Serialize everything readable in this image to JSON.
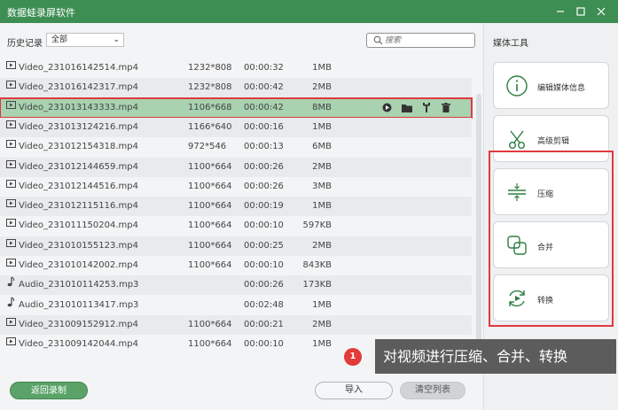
{
  "app": {
    "title": "数据蛙录屏软件"
  },
  "toolbar": {
    "history_label": "历史记录",
    "filter_value": "全部",
    "search_placeholder": "搜索"
  },
  "files": [
    {
      "type": "video",
      "name": "Video_231016142514.mp4",
      "resolution": "1232*808",
      "duration": "00:00:32",
      "size": "1MB"
    },
    {
      "type": "video",
      "name": "Video_231016142317.mp4",
      "resolution": "1232*808",
      "duration": "00:00:42",
      "size": "2MB"
    },
    {
      "type": "video",
      "name": "Video_231013143333.mp4",
      "resolution": "1106*668",
      "duration": "00:00:42",
      "size": "8MB",
      "selected": true
    },
    {
      "type": "video",
      "name": "Video_231013124216.mp4",
      "resolution": "1166*640",
      "duration": "00:00:16",
      "size": "1MB"
    },
    {
      "type": "video",
      "name": "Video_231012154318.mp4",
      "resolution": "972*546",
      "duration": "00:00:13",
      "size": "6MB"
    },
    {
      "type": "video",
      "name": "Video_231012144659.mp4",
      "resolution": "1100*664",
      "duration": "00:00:26",
      "size": "2MB"
    },
    {
      "type": "video",
      "name": "Video_231012144516.mp4",
      "resolution": "1100*664",
      "duration": "00:00:26",
      "size": "3MB"
    },
    {
      "type": "video",
      "name": "Video_231012115116.mp4",
      "resolution": "1100*664",
      "duration": "00:00:19",
      "size": "1MB"
    },
    {
      "type": "video",
      "name": "Video_231011150204.mp4",
      "resolution": "1100*664",
      "duration": "00:00:10",
      "size": "597KB"
    },
    {
      "type": "video",
      "name": "Video_231010155123.mp4",
      "resolution": "1100*664",
      "duration": "00:00:25",
      "size": "2MB"
    },
    {
      "type": "video",
      "name": "Video_231010142002.mp4",
      "resolution": "1100*664",
      "duration": "00:00:10",
      "size": "843KB"
    },
    {
      "type": "audio",
      "name": "Audio_231010114253.mp3",
      "resolution": "",
      "duration": "00:00:26",
      "size": "173KB"
    },
    {
      "type": "audio",
      "name": "Audio_231010113417.mp3",
      "resolution": "",
      "duration": "00:02:48",
      "size": "1MB"
    },
    {
      "type": "video",
      "name": "Video_231009152912.mp4",
      "resolution": "1100*664",
      "duration": "00:00:21",
      "size": "2MB"
    },
    {
      "type": "video",
      "name": "Video_231009142044.mp4",
      "resolution": "1100*664",
      "duration": "00:00:10",
      "size": "1MB"
    }
  ],
  "row_actions": [
    "play-icon",
    "folder-icon",
    "tools-icon",
    "trash-icon"
  ],
  "footer": {
    "back_label": "返回录制",
    "import_label": "导入",
    "clear_label": "清空列表"
  },
  "sidebar": {
    "title": "媒体工具",
    "tools": [
      {
        "icon": "info-icon",
        "label": "编辑媒体信息"
      },
      {
        "icon": "scissors-icon",
        "label": "高级剪辑"
      },
      {
        "icon": "compress-icon",
        "label": "压缩"
      },
      {
        "icon": "merge-icon",
        "label": "合并"
      },
      {
        "icon": "convert-icon",
        "label": "转换"
      }
    ]
  },
  "tip": {
    "badge": "1",
    "text": "对视频进行压缩、合并、转换"
  },
  "colors": {
    "brand": "#3d8e53",
    "accent_green": "#5aa268",
    "selection": "#a8d2b0",
    "highlight_red": "#e0393e",
    "tooltip_bg": "#5c5c5c"
  }
}
